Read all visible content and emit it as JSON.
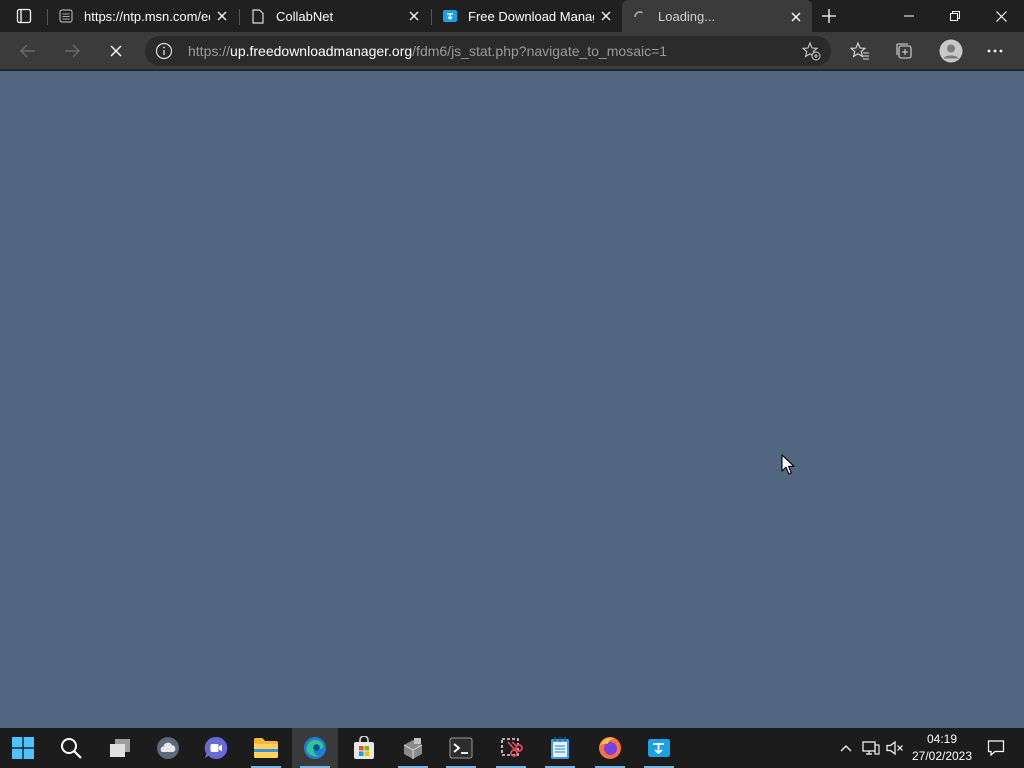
{
  "browser": {
    "tabs": [
      {
        "title": "https://ntp.msn.com/ed",
        "favicon": "msn-icon",
        "active": false
      },
      {
        "title": "CollabNet",
        "favicon": "page-icon",
        "active": false
      },
      {
        "title": "Free Download Manage",
        "favicon": "fdm-icon",
        "active": false
      },
      {
        "title": "Loading...",
        "favicon": "loading-spinner-icon",
        "active": true
      }
    ],
    "address": {
      "prefix": "https://",
      "host": "up.freedownloadmanager.org",
      "path": "/fdm6/js_stat.php?navigate_to_mosaic=1"
    },
    "page_background": "#516680"
  },
  "taskbar": {
    "apps": [
      {
        "name": "start-button",
        "icon": "windows-logo-icon"
      },
      {
        "name": "search-button",
        "icon": "search-icon"
      },
      {
        "name": "task-view-button",
        "icon": "task-view-icon"
      },
      {
        "name": "widgets-button",
        "icon": "weather-icon"
      },
      {
        "name": "chat-button",
        "icon": "teams-chat-icon"
      },
      {
        "name": "file-explorer-button",
        "icon": "folder-icon"
      },
      {
        "name": "edge-button",
        "icon": "edge-icon",
        "active": true
      },
      {
        "name": "store-button",
        "icon": "store-icon"
      },
      {
        "name": "app-button",
        "icon": "package-icon"
      },
      {
        "name": "terminal-button",
        "icon": "terminal-icon"
      },
      {
        "name": "snip-button",
        "icon": "snip-icon"
      },
      {
        "name": "notepad-button",
        "icon": "notepad-icon"
      },
      {
        "name": "firefox-button",
        "icon": "firefox-icon"
      },
      {
        "name": "fdm-button",
        "icon": "fdm-icon"
      }
    ],
    "clock": {
      "time": "04:19",
      "date": "27/02/2023"
    }
  }
}
